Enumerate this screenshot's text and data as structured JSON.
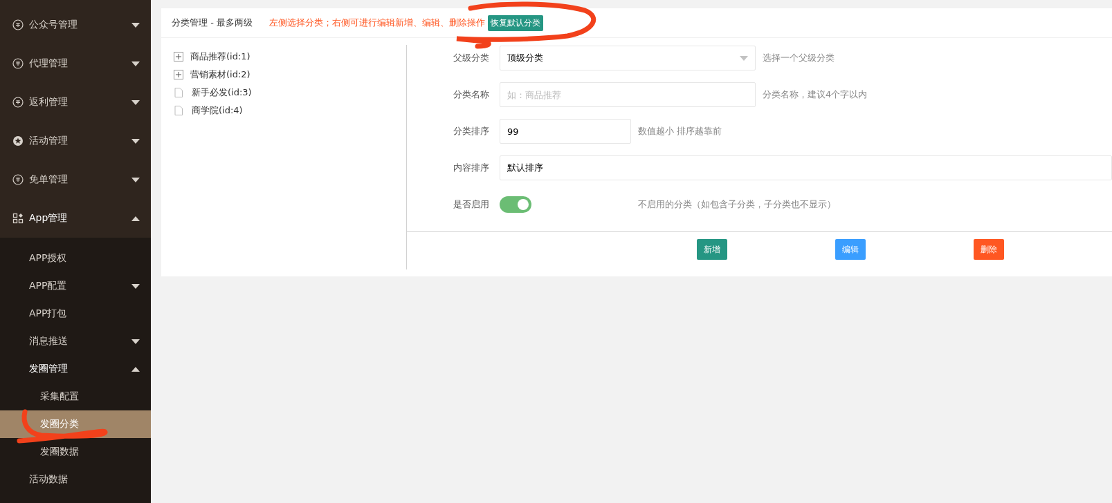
{
  "sidebar": {
    "items": [
      {
        "kind": "group",
        "label": "公众号管理",
        "expanded": false,
        "selected": false
      },
      {
        "kind": "group",
        "label": "代理管理",
        "expanded": false,
        "selected": false
      },
      {
        "kind": "group",
        "label": "返利管理",
        "expanded": false,
        "selected": false
      },
      {
        "kind": "group",
        "label": "活动管理",
        "expanded": false,
        "selected": false
      },
      {
        "kind": "group",
        "label": "免单管理",
        "expanded": false,
        "selected": false
      },
      {
        "kind": "group",
        "label": "App管理",
        "expanded": true,
        "selected": false,
        "children": [
          {
            "kind": "link",
            "label": "APP授权",
            "selected": false
          },
          {
            "kind": "group",
            "label": "APP配置",
            "expanded": false,
            "selected": false
          },
          {
            "kind": "link",
            "label": "APP打包",
            "selected": false
          },
          {
            "kind": "group",
            "label": "消息推送",
            "expanded": false,
            "selected": false
          },
          {
            "kind": "group",
            "label": "发圈管理",
            "expanded": true,
            "selected": false,
            "children": [
              {
                "kind": "link",
                "label": "采集配置",
                "selected": false
              },
              {
                "kind": "link",
                "label": "发圈分类",
                "selected": true
              },
              {
                "kind": "link",
                "label": "发圈数据",
                "selected": false
              }
            ]
          },
          {
            "kind": "link",
            "label": "活动数据",
            "selected": false
          }
        ]
      }
    ]
  },
  "panel": {
    "title": "分类管理 - 最多两级",
    "notice": "左侧选择分类；右侧可进行编辑新增、编辑、删除操作",
    "reset_button": "恢复默认分类"
  },
  "tree": [
    {
      "kind": "folder",
      "label": "商品推荐(id:1)",
      "expanded": false
    },
    {
      "kind": "folder",
      "label": "营销素材(id:2)",
      "expanded": false
    },
    {
      "kind": "file",
      "label": "新手必发(id:3)"
    },
    {
      "kind": "file",
      "label": "商学院(id:4)"
    }
  ],
  "form": {
    "fields": [
      {
        "kind": "select",
        "label": "父级分类",
        "value": "顶级分类",
        "help": "选择一个父级分类"
      },
      {
        "kind": "text",
        "label": "分类名称",
        "placeholder": "如：商品推荐",
        "help": "分类名称，建议4个字以内"
      },
      {
        "kind": "number",
        "label": "分类排序",
        "value": "99",
        "help": "数值越小 排序越靠前"
      },
      {
        "kind": "wide",
        "label": "内容排序",
        "value": "默认排序"
      },
      {
        "kind": "toggle",
        "label": "是否启用",
        "on": true,
        "help": "不启用的分类（如包含子分类，子分类也不显示）"
      }
    ],
    "buttons": [
      {
        "label": "新增",
        "color": "#259683"
      },
      {
        "label": "编辑",
        "color": "#3a9eff"
      },
      {
        "label": "删除",
        "color": "#ff5722"
      }
    ]
  },
  "annotations": [
    {
      "kind": "loop",
      "color": "#f2411b"
    },
    {
      "kind": "loop",
      "color": "#f2411b"
    }
  ]
}
